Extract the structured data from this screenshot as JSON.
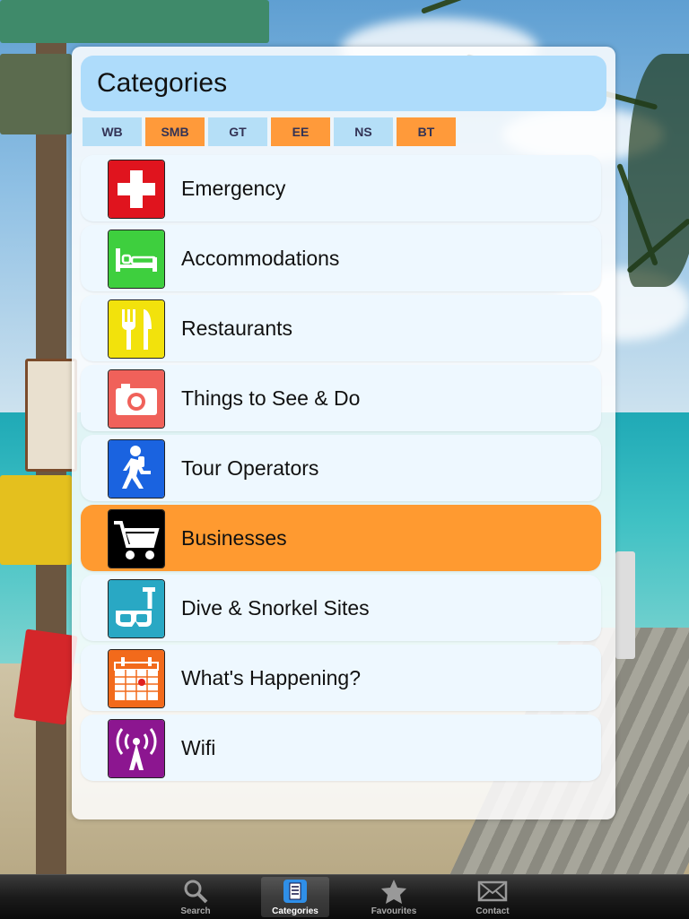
{
  "header": {
    "title": "Categories"
  },
  "filters": [
    {
      "label": "WB",
      "color": "#b5dff7"
    },
    {
      "label": "SMB",
      "color": "#ff9a3a"
    },
    {
      "label": "GT",
      "color": "#b5dff7"
    },
    {
      "label": "EE",
      "color": "#ff9a3a"
    },
    {
      "label": "NS",
      "color": "#b5dff7"
    },
    {
      "label": "BT",
      "color": "#ff9a3a"
    }
  ],
  "categories": [
    {
      "label": "Emergency",
      "icon": "first-aid-cross-icon",
      "icon_color": "#e0141e"
    },
    {
      "label": "Accommodations",
      "icon": "bed-icon",
      "icon_color": "#3ecf3e"
    },
    {
      "label": "Restaurants",
      "icon": "fork-knife-icon",
      "icon_color": "#f2e20c"
    },
    {
      "label": "Things to See & Do",
      "icon": "camera-icon",
      "icon_color": "#f0615a"
    },
    {
      "label": "Tour Operators",
      "icon": "hiker-icon",
      "icon_color": "#1a63e0"
    },
    {
      "label": "Businesses",
      "icon": "shopping-cart-icon",
      "icon_color": "#000000",
      "selected": true
    },
    {
      "label": "Dive & Snorkel Sites",
      "icon": "snorkel-mask-icon",
      "icon_color": "#29a8c4"
    },
    {
      "label": "What's Happening?",
      "icon": "calendar-icon",
      "icon_color": "#f26a1b"
    },
    {
      "label": "Wifi",
      "icon": "wifi-antenna-icon",
      "icon_color": "#8c1690"
    }
  ],
  "tabbar": {
    "items": [
      {
        "label": "Search",
        "icon": "magnifier-icon"
      },
      {
        "label": "Categories",
        "icon": "document-list-icon",
        "active": true
      },
      {
        "label": "Favourites",
        "icon": "star-icon"
      },
      {
        "label": "Contact",
        "icon": "envelope-icon"
      }
    ]
  },
  "colors": {
    "selected_row": "#ff9a30",
    "row_bg": "#eef8ff",
    "title_bar": "#aedcfb"
  }
}
